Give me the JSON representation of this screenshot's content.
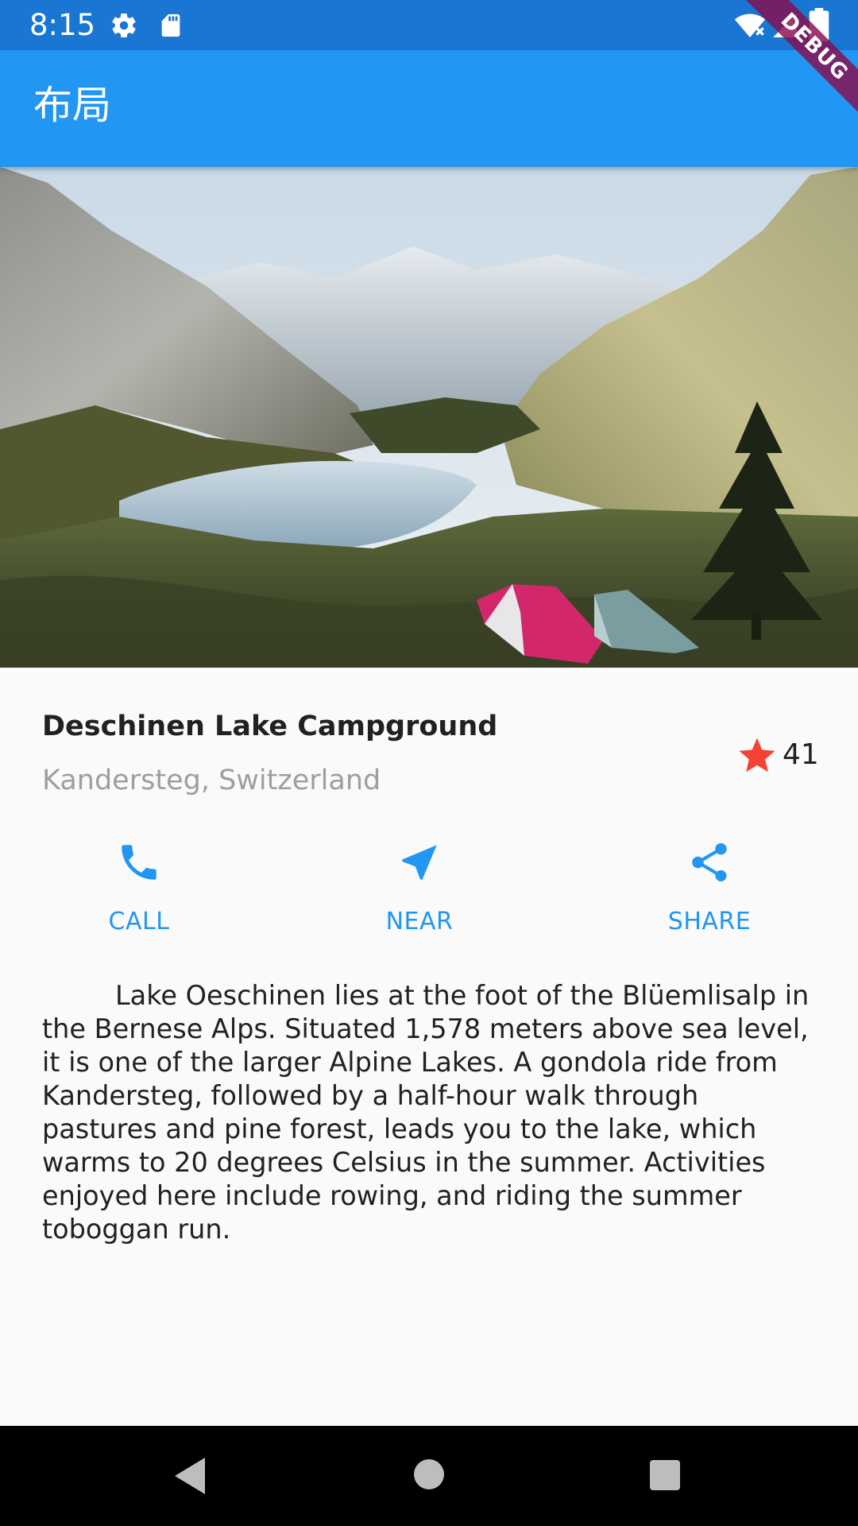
{
  "status_bar": {
    "time": "8:15",
    "left_icons": [
      "gear-icon",
      "sd-card-icon"
    ],
    "right_icons": [
      "wifi-icon",
      "signal-icon",
      "battery-icon"
    ]
  },
  "debug_banner": "DEBUG",
  "app_bar": {
    "title": "布局"
  },
  "hero_image": {
    "description_icon": "landscape-photo"
  },
  "title_section": {
    "name": "Deschinen Lake Campground",
    "location": "Kandersteg, Switzerland",
    "rating_count": "41",
    "star_color": "#f44336"
  },
  "actions": [
    {
      "label": "CALL",
      "icon": "phone-icon"
    },
    {
      "label": "NEAR",
      "icon": "navigation-icon"
    },
    {
      "label": "SHARE",
      "icon": "share-icon"
    }
  ],
  "description": "Lake Oeschinen lies at the foot of the Blüemlisalp in the Bernese Alps. Situated 1,578 meters above sea level, it is one of the larger Alpine Lakes. A gondola ride from Kandersteg, followed by a half-hour walk through pastures and pine forest, leads you to the lake, which warms to 20 degrees Celsius in the summer. Activities enjoyed here include rowing, and riding the summer toboggan run.",
  "nav_bar": {
    "buttons": [
      "back-icon",
      "home-icon",
      "recents-icon"
    ]
  },
  "colors": {
    "primary": "#2196f3",
    "primary_dark": "#1976d2",
    "background": "#fafafa"
  }
}
